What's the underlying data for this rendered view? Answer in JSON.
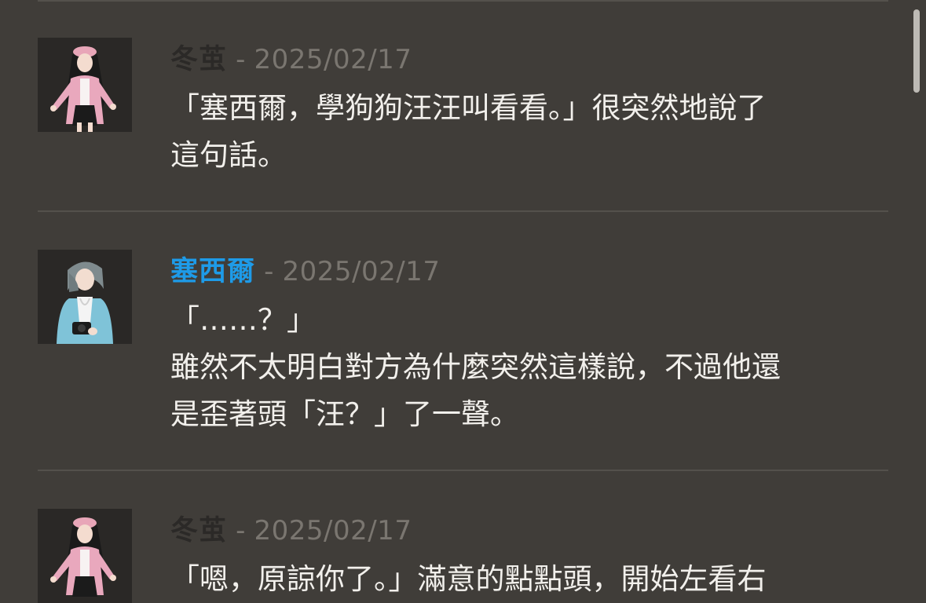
{
  "posts": [
    {
      "author": "冬茧",
      "separator": "-",
      "date": "2025/02/17",
      "lines": [
        "「塞西爾，學狗狗汪汪叫看看。」很突然地說了",
        "這句話。"
      ]
    },
    {
      "author": "塞西爾",
      "separator": "-",
      "date": "2025/02/17",
      "lines": [
        "「……？」",
        "雖然不太明白對方為什麼突然這樣說，不過他還",
        "是歪著頭「汪？」了一聲。"
      ]
    },
    {
      "author": "冬茧",
      "separator": "-",
      "date": "2025/02/17",
      "lines": [
        "「嗯，原諒你了。」滿意的點點頭，開始左看右"
      ]
    }
  ],
  "colors": {
    "background": "#403d39",
    "author_default": "#2b2927",
    "author_highlight": "#1e9be8",
    "date": "#7a7670",
    "text": "#f2f0ec",
    "divider": "#54514c"
  }
}
